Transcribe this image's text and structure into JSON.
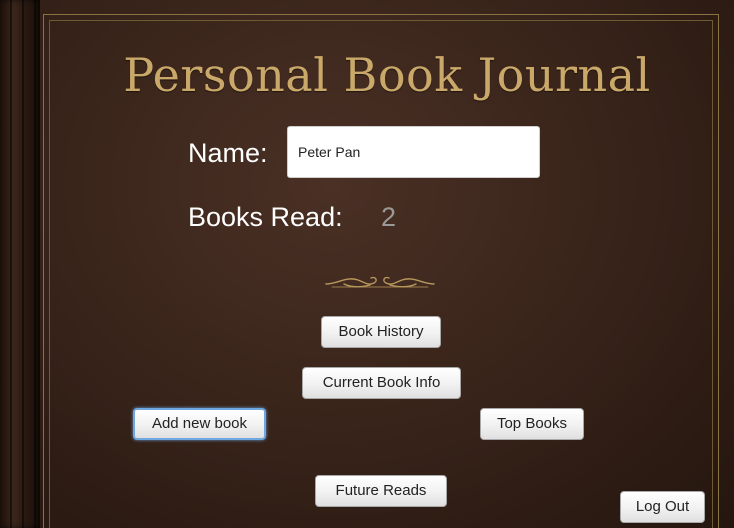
{
  "app": {
    "title": "Personal Book Journal"
  },
  "profile": {
    "name_label": "Name:",
    "name_value": "Peter Pan",
    "books_read_label": "Books Read:",
    "books_read_count": "2"
  },
  "menu": {
    "book_history": "Book History",
    "current_book_info": "Current Book Info",
    "add_new_book": "Add new book",
    "top_books": "Top Books",
    "future_reads": "Future Reads",
    "log_out": "Log Out"
  },
  "colors": {
    "leather": "#3a251b",
    "gold": "#c9a86a",
    "focus": "#6fa8e0"
  },
  "icons": {
    "ornament": "flourish-ornament-icon"
  }
}
